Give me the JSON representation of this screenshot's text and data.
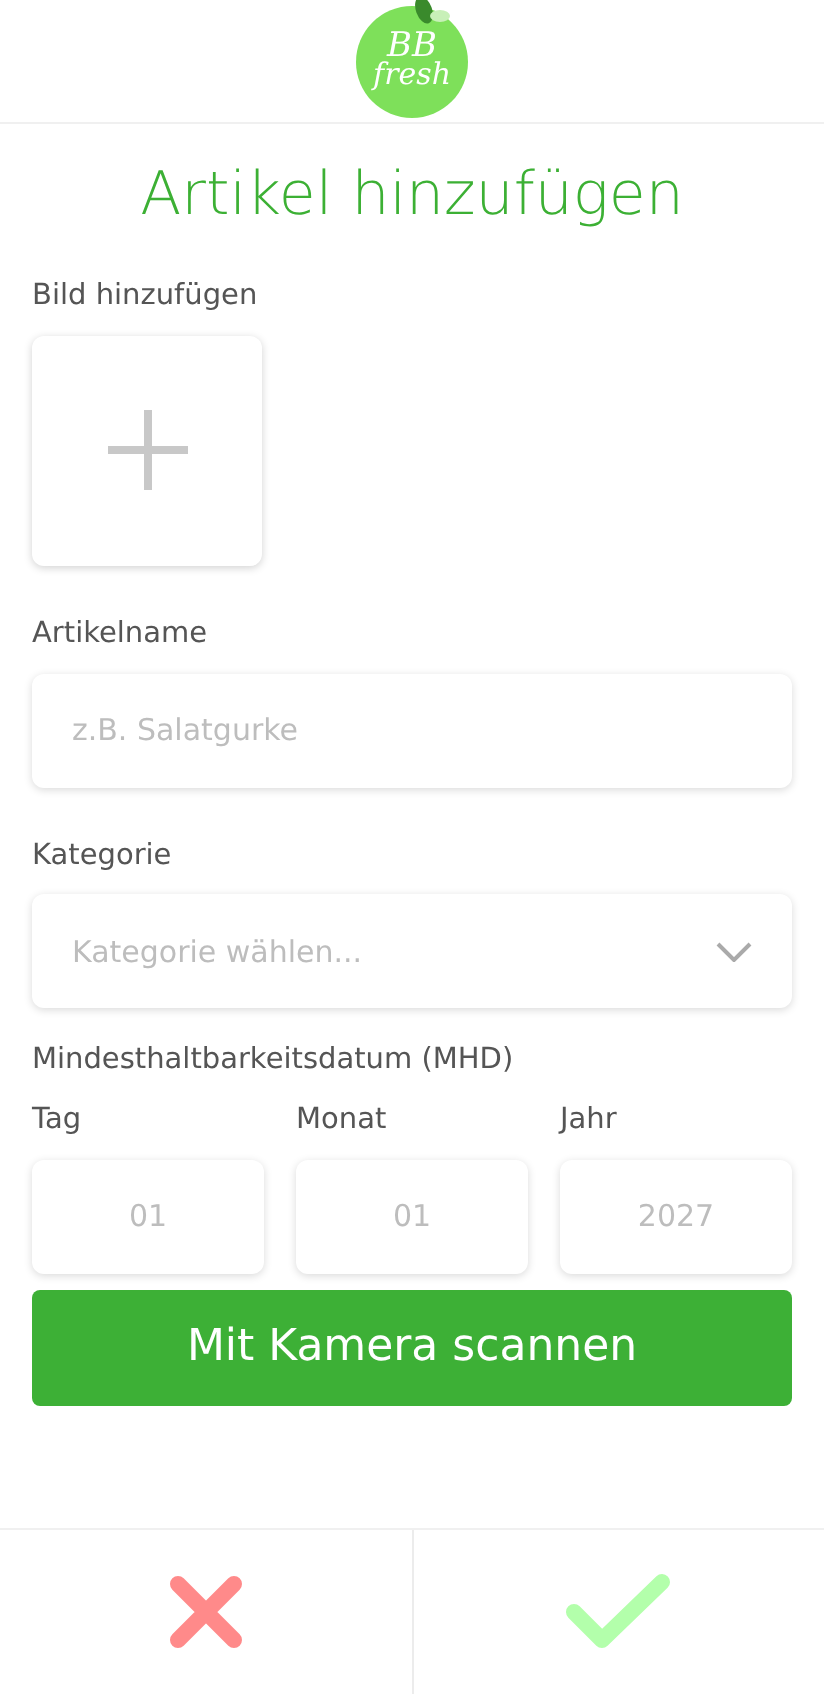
{
  "logo": {
    "line_1": "BB",
    "line_2": "fresh"
  },
  "title": "Artikel hinzufügen",
  "image": {
    "label": "Bild hinzufügen"
  },
  "name": {
    "label": "Artikelname",
    "placeholder": "z.B. Salatgurke"
  },
  "category": {
    "label": "Kategorie",
    "placeholder": "Kategorie wählen..."
  },
  "best_before": {
    "label": "Mindesthaltbarkeitsdatum (MHD)",
    "fields": [
      {
        "label": "Tag",
        "placeholder": "01"
      },
      {
        "label": "Monat",
        "placeholder": "01"
      },
      {
        "label": "Jahr",
        "placeholder": "2027"
      }
    ]
  },
  "scan_button": "Mit Kamera scannen",
  "footer": [
    {
      "kind": "cancel"
    },
    {
      "kind": "confirm"
    }
  ]
}
